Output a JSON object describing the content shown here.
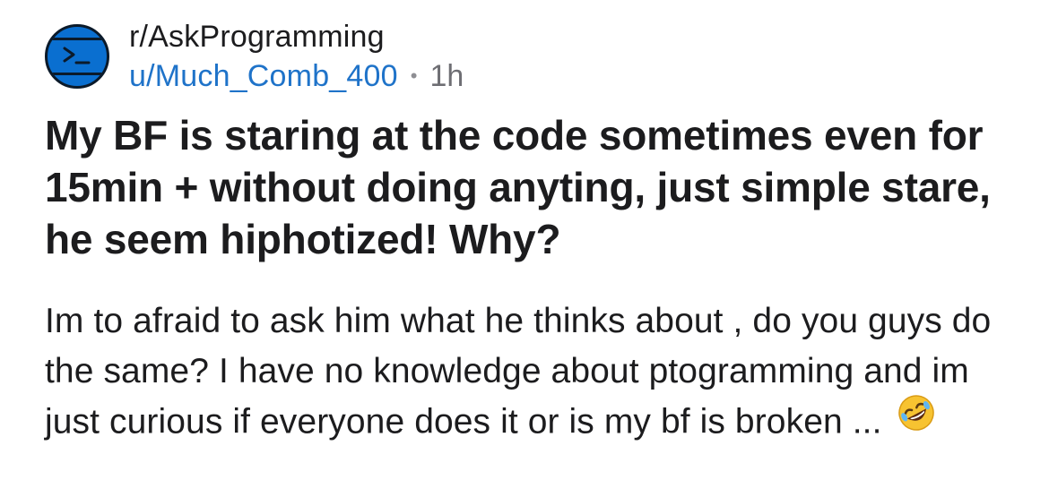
{
  "post": {
    "subreddit": "r/AskProgramming",
    "author": "u/Much_Comb_400",
    "separator": "•",
    "age": "1h",
    "title": "My BF is staring at the code sometimes even for 15min + without doing anyting, just simple stare, he seem hiphotized! Why?",
    "body": "Im to afraid to ask him what he thinks about , do you guys do the same? I have no knowledge about ptogramming and im just curious if everyone does it or is my bf is broken ...",
    "emoji_icon": "rolling-on-floor-laughing-emoji"
  },
  "colors": {
    "username": "#1f73c9",
    "avatar_bg": "#0a6fd0",
    "text": "#1c1c1e",
    "muted": "#6e6e73"
  }
}
